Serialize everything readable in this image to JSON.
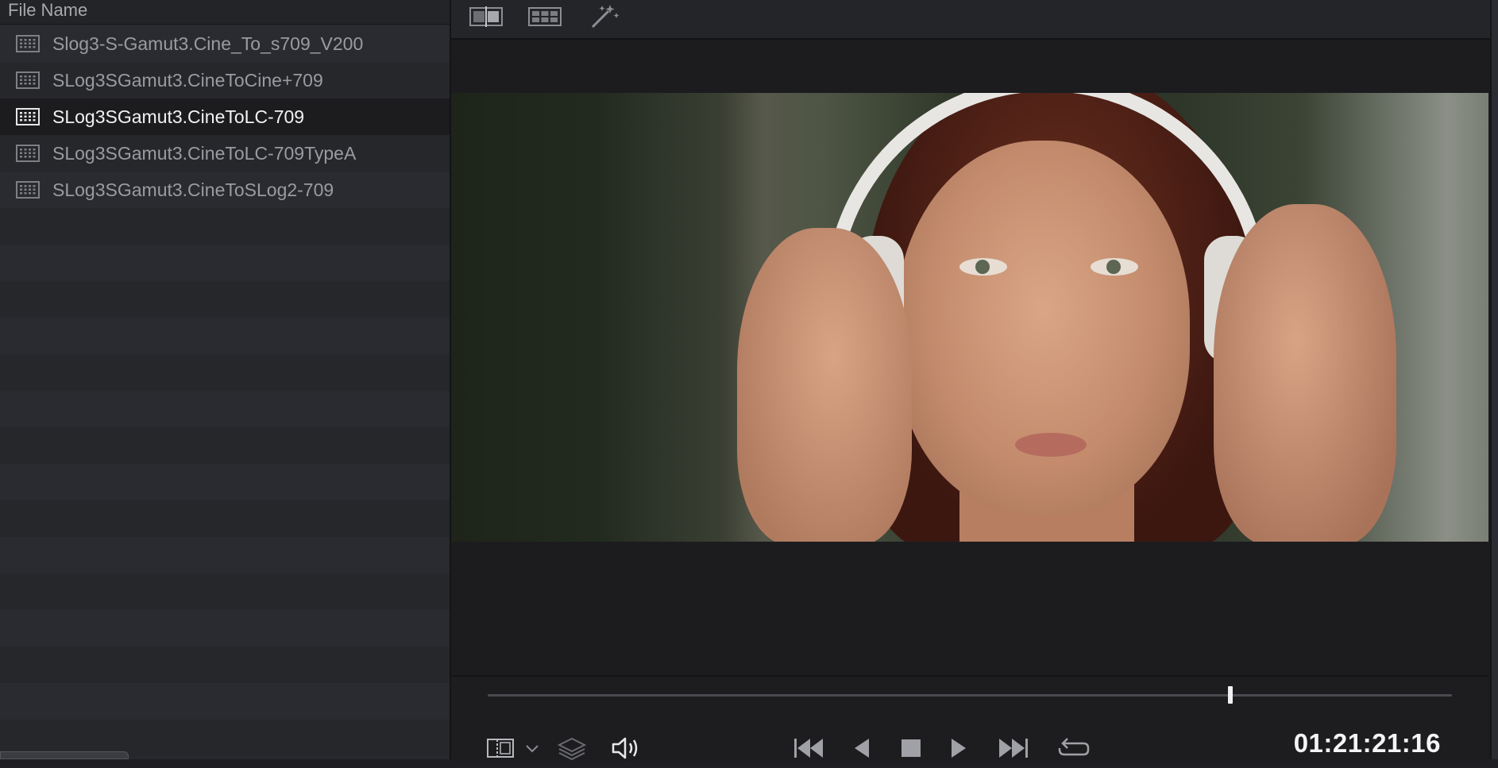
{
  "left_panel": {
    "header": "File Name",
    "items": [
      {
        "label": "Slog3-S-Gamut3.Cine_To_s709_V200",
        "selected": false
      },
      {
        "label": "SLog3SGamut3.CineToCine+709",
        "selected": false
      },
      {
        "label": "SLog3SGamut3.CineToLC-709",
        "selected": true
      },
      {
        "label": "SLog3SGamut3.CineToLC-709TypeA",
        "selected": false
      },
      {
        "label": "SLog3SGamut3.CineToSLog2-709",
        "selected": false
      }
    ],
    "item_icon": "lut-grid-icon"
  },
  "viewer_toolbar": {
    "icons": [
      "split-view-icon",
      "grid-view-icon",
      "magic-wand-icon"
    ]
  },
  "viewer": {
    "image": "woman-with-headphones-frame",
    "playhead_progress": 0.77
  },
  "transport": {
    "icons": [
      "viewer-mode-icon",
      "chevron-down-icon",
      "layers-icon",
      "volume-icon",
      "skip-to-start-icon",
      "step-back-icon",
      "stop-icon",
      "play-icon",
      "skip-to-end-icon",
      "loop-icon"
    ],
    "timecode": "01:21:21:16"
  },
  "colors": {
    "panel_bg": "#27282d",
    "selected_row": "#1c1c1f",
    "viewer_bg": "#1c1c1f",
    "text_dim": "#9a9ba0",
    "text_bright": "#f2f2f2"
  }
}
